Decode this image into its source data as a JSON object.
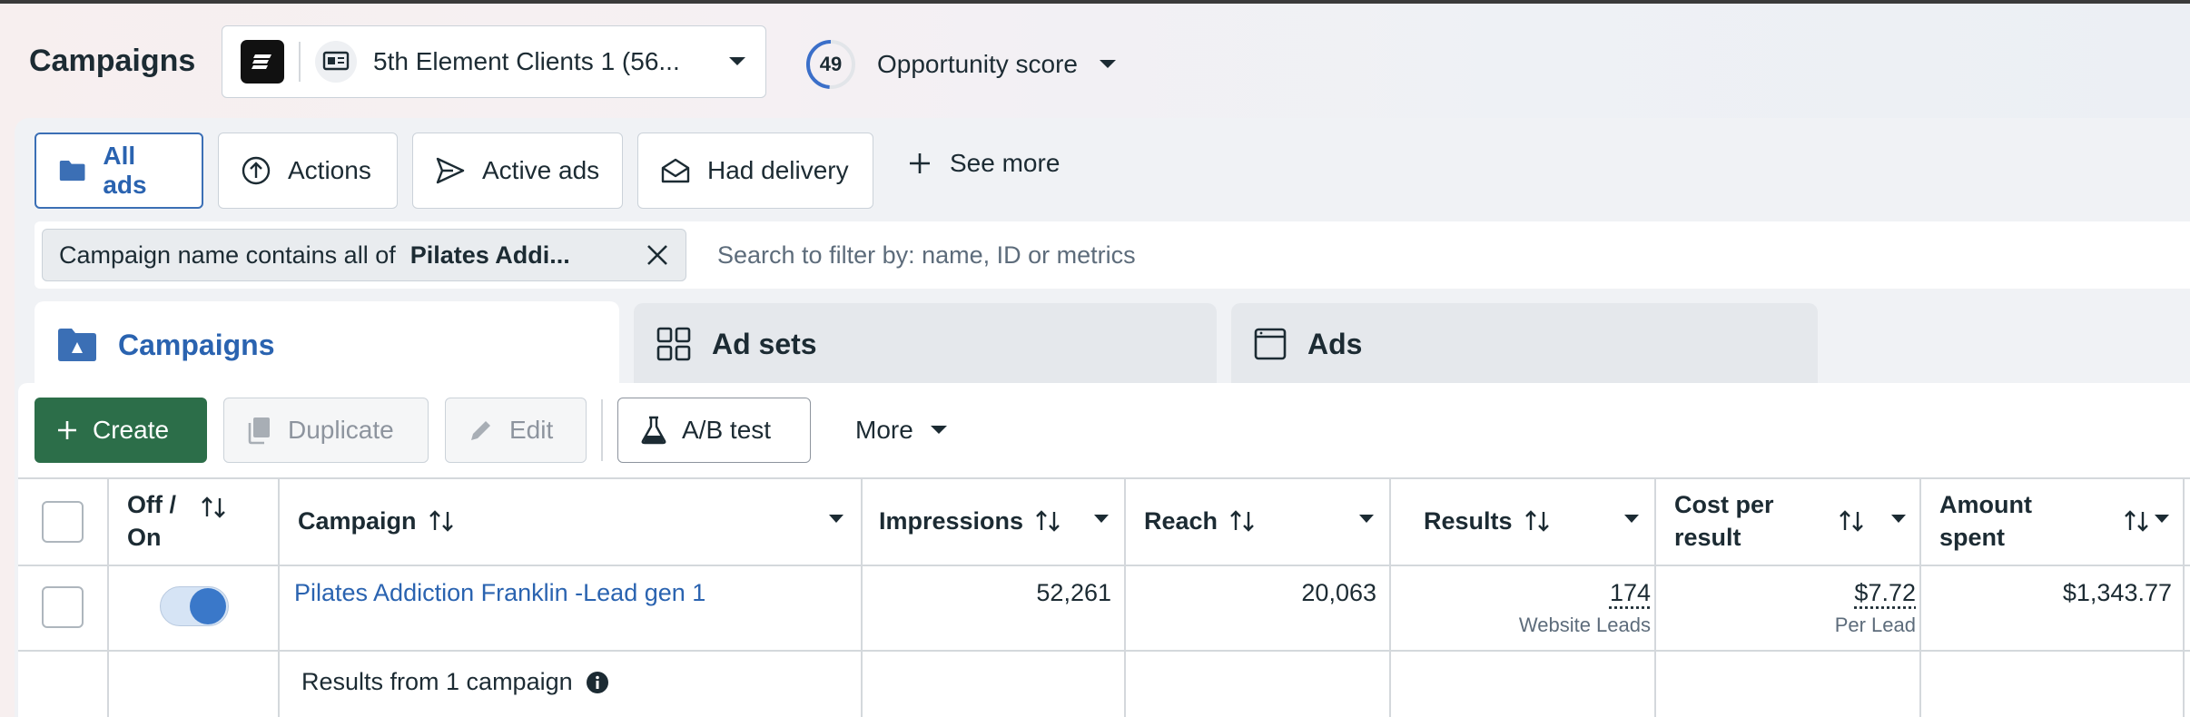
{
  "header": {
    "title": "Campaigns",
    "account_name": "5th Element Clients 1 (56...",
    "opportunity_score": "49",
    "opportunity_label": "Opportunity score"
  },
  "filters": {
    "buttons": [
      {
        "label": "All ads",
        "icon": "folder-icon",
        "active": true
      },
      {
        "label": "Actions",
        "icon": "arrow-up-circle-icon"
      },
      {
        "label": "Active ads",
        "icon": "send-icon"
      },
      {
        "label": "Had delivery",
        "icon": "envelope-icon"
      }
    ],
    "see_more": "See more"
  },
  "search": {
    "chip_prefix": "Campaign name contains all of",
    "chip_value": "Pilates Addi...",
    "placeholder": "Search to filter by: name, ID or metrics"
  },
  "level_tabs": [
    {
      "label": "Campaigns",
      "icon": "campaign-folder-icon",
      "active": true
    },
    {
      "label": "Ad sets",
      "icon": "grid-icon"
    },
    {
      "label": "Ads",
      "icon": "ad-window-icon"
    }
  ],
  "toolbar": {
    "create": "Create",
    "duplicate": "Duplicate",
    "edit": "Edit",
    "ab_test": "A/B test",
    "more": "More"
  },
  "table": {
    "columns": {
      "off_on_1": "Off /",
      "off_on_2": "On",
      "campaign": "Campaign",
      "impressions": "Impressions",
      "reach": "Reach",
      "results": "Results",
      "cost_per_result_1": "Cost per",
      "cost_per_result_2": "result",
      "amount_spent_1": "Amount",
      "amount_spent_2": "spent"
    },
    "rows": [
      {
        "on": true,
        "campaign": "Pilates Addiction Franklin -Lead gen 1",
        "impressions": "52,261",
        "reach": "20,063",
        "results": "174",
        "results_sub": "Website Leads",
        "cost_per_result": "$7.72",
        "cost_sub": "Per Lead",
        "amount_spent": "$1,343.77"
      }
    ],
    "summary": "Results from 1 campaign"
  },
  "colors": {
    "accent": "#2a63b0",
    "create_green": "#2c6e49",
    "toggle_on": "#3a78c9"
  }
}
